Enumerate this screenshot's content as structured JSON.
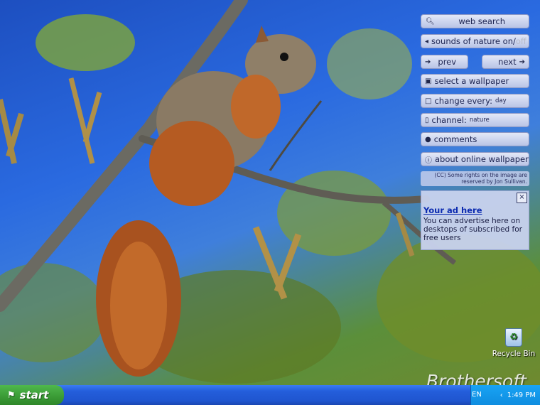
{
  "widget": {
    "web_search": "web search",
    "sounds_prefix": "sounds of nature on/",
    "sounds_off": "off",
    "prev": "prev",
    "next": "next",
    "select_wallpaper": "select a wallpaper",
    "change_every_label": "change every:",
    "change_every_value": "day",
    "channel_label": "channel:",
    "channel_value": "nature",
    "comments": "comments",
    "about": "about online wallpaper",
    "credit": "(CC) Some rights on the image are reserved by Jon Sullivan."
  },
  "ad": {
    "close": "×",
    "title": "Your ad here",
    "text": "You can advertise here on desktops of subscribed for free users"
  },
  "desktop": {
    "recycle_bin": "Recycle Bin",
    "watermark": "Brothersoft"
  },
  "taskbar": {
    "start": "start",
    "language": "EN",
    "clock": "1:49 PM"
  }
}
